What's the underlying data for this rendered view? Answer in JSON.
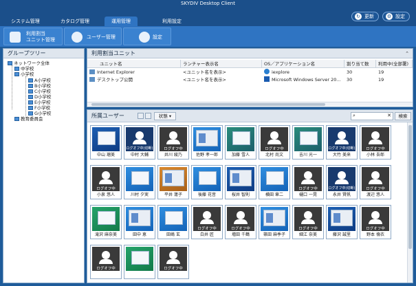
{
  "window": {
    "title": "SKYDIV Desktop Client"
  },
  "tabs": [
    {
      "label": "システム管理"
    },
    {
      "label": "カタログ管理"
    },
    {
      "label": "運用管理"
    },
    {
      "label": "利用設定"
    }
  ],
  "top_buttons": {
    "refresh": "更新",
    "settings": "設定"
  },
  "toolbar": {
    "unit_mgmt_line1": "利用割当",
    "unit_mgmt_line2": "ユニット管理",
    "user_mgmt": "ユーザー管理",
    "settings": "設定"
  },
  "group_tree": {
    "title": "グループツリー",
    "items": [
      {
        "label": "ネットワーク全体"
      },
      {
        "label": "中学校"
      },
      {
        "label": "小学校"
      },
      {
        "label": "A小学校"
      },
      {
        "label": "B小学校"
      },
      {
        "label": "C小学校"
      },
      {
        "label": "D小学校"
      },
      {
        "label": "E小学校"
      },
      {
        "label": "F小学校"
      },
      {
        "label": "G小学校"
      },
      {
        "label": "教育委員会"
      }
    ]
  },
  "units": {
    "title": "利用割当ユニット",
    "columns": [
      "ユニット名",
      "ランチャー表示名",
      "OS／アプリケーション名",
      "割り当て数",
      "利用中(全部署)"
    ],
    "rows": [
      {
        "name": "Internet Explorer",
        "launcher": "<ユニット名を表示>",
        "app": "iexplore",
        "assigned": "30",
        "in_use": "19"
      },
      {
        "name": "デスクトップ公開",
        "launcher": "<ユニット名を表示>",
        "app": "Microsoft Windows Server 20...",
        "assigned": "30",
        "in_use": "19"
      }
    ]
  },
  "users": {
    "title": "所属ユーザー",
    "status_filter": "状態",
    "search_placeholder": "",
    "search_button": "検索",
    "tiles": [
      {
        "name": "中山 瑠美",
        "state": "desk",
        "style": "desk-blue",
        "status": ""
      },
      {
        "name": "中村 大輔",
        "state": "logoff2",
        "style": "",
        "status": "ログオフ中(切断)"
      },
      {
        "name": "井川 綾乃",
        "state": "logoff",
        "style": "",
        "status": "ログオフ中"
      },
      {
        "name": "佐野 孝一郎",
        "state": "desk",
        "style": "desk-sky",
        "status": ""
      },
      {
        "name": "加藤 雪人",
        "state": "desk",
        "style": "desk-teal",
        "status": ""
      },
      {
        "name": "北村 尚文",
        "state": "logoff",
        "style": "",
        "status": "ログオフ中"
      },
      {
        "name": "吉川 光一",
        "state": "desk",
        "style": "desk-teal",
        "status": ""
      },
      {
        "name": "大竹 美来",
        "state": "logoff2",
        "style": "",
        "status": "ログオフ中(切断)"
      },
      {
        "name": "小林 吾郎",
        "state": "logoff",
        "style": "",
        "status": "ログオフ中"
      },
      {
        "name": "小泉 悠人",
        "state": "logoff",
        "style": "",
        "status": "ログオフ中"
      },
      {
        "name": "川村 夕実",
        "state": "desk",
        "style": "desk-sky",
        "status": ""
      },
      {
        "name": "平井 蓮子",
        "state": "desk",
        "style": "desk-orange",
        "status": ""
      },
      {
        "name": "後藤 花音",
        "state": "desk",
        "style": "desk-sky",
        "status": ""
      },
      {
        "name": "桜井 智則",
        "state": "desk",
        "style": "desk-blue",
        "status": ""
      },
      {
        "name": "横田 章二",
        "state": "desk",
        "style": "desk-sky",
        "status": ""
      },
      {
        "name": "樋口 一晃",
        "state": "logoff",
        "style": "",
        "status": "ログオフ中"
      },
      {
        "name": "永井 賢帆",
        "state": "logoff2",
        "style": "",
        "status": "ログオフ中(切断)"
      },
      {
        "name": "渡辺 悠人",
        "state": "logoff",
        "style": "",
        "status": "ログオフ中"
      },
      {
        "name": "滝沢 麻奈美",
        "state": "desk",
        "style": "desk-green",
        "status": ""
      },
      {
        "name": "田中 恵",
        "state": "desk",
        "style": "desk-sky",
        "status": ""
      },
      {
        "name": "田嶋 玄",
        "state": "desk",
        "style": "desk-sky",
        "status": ""
      },
      {
        "name": "白井 匠",
        "state": "logoff",
        "style": "",
        "status": "ログオフ中"
      },
      {
        "name": "増田 千鶴",
        "state": "logoff",
        "style": "",
        "status": "ログオフ中"
      },
      {
        "name": "篠田 麻季子",
        "state": "desk",
        "style": "desk-sky",
        "status": ""
      },
      {
        "name": "細江 奈美",
        "state": "logoff",
        "style": "",
        "status": "ログオフ中"
      },
      {
        "name": "藤沢 誠里",
        "state": "desk",
        "style": "desk-blue",
        "status": ""
      },
      {
        "name": "野本 倫衣",
        "state": "logoff",
        "style": "",
        "status": "ログオフ中"
      },
      {
        "name": "",
        "state": "logoff",
        "style": "",
        "status": "ログオフ中"
      },
      {
        "name": "",
        "state": "desk",
        "style": "desk-green",
        "status": ""
      },
      {
        "name": "",
        "state": "logoff",
        "style": "",
        "status": "ログオフ中"
      }
    ]
  }
}
